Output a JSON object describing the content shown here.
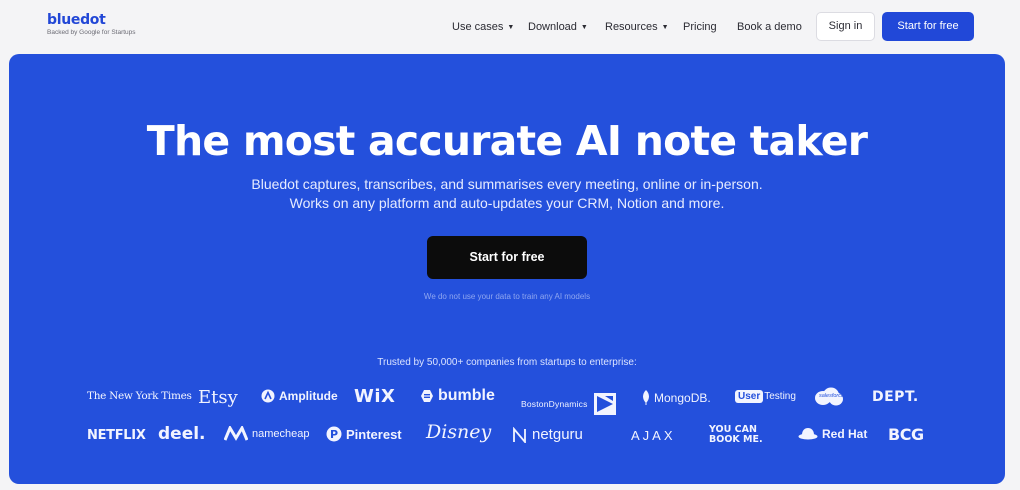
{
  "brand": {
    "name": "bluedot",
    "tagline": "Backed by Google for Startups",
    "color": "#2247d6"
  },
  "nav": {
    "items": [
      {
        "label": "Use cases",
        "has_dropdown": true
      },
      {
        "label": "Download",
        "has_dropdown": true
      },
      {
        "label": "Resources",
        "has_dropdown": true
      },
      {
        "label": "Pricing",
        "has_dropdown": false
      },
      {
        "label": "Book a demo",
        "has_dropdown": false
      }
    ],
    "dropdown_glyph": "▼",
    "sign_in_label": "Sign in",
    "start_label": "Start for free"
  },
  "hero": {
    "background": "#2450dc",
    "title": "The most accurate AI note taker",
    "subtitle_line1": "Bluedot captures, transcribes, and summarises every meeting, online or in-person.",
    "subtitle_line2": "Works on any platform and auto-updates your CRM, Notion and more.",
    "cta_label": "Start for free",
    "note": "We do not use your data to train any AI models",
    "trusted_text": "Trusted by 50,000+ companies from startups to enterprise:"
  },
  "logos": {
    "row1": [
      "The New York Times",
      "Etsy",
      "Amplitude",
      "WiX",
      "bumble",
      "BostonDynamics",
      "MongoDB.",
      "UserTesting",
      "salesforce",
      "DEPT."
    ],
    "row2": [
      "NETFLIX",
      "deel.",
      "namecheap",
      "Pinterest",
      "Disney",
      "netguru",
      "AJAX",
      "YOU CAN",
      "BOOK ME.",
      "Red Hat",
      "BCG"
    ],
    "user_badge": "User",
    "testing_word": "Testing"
  }
}
